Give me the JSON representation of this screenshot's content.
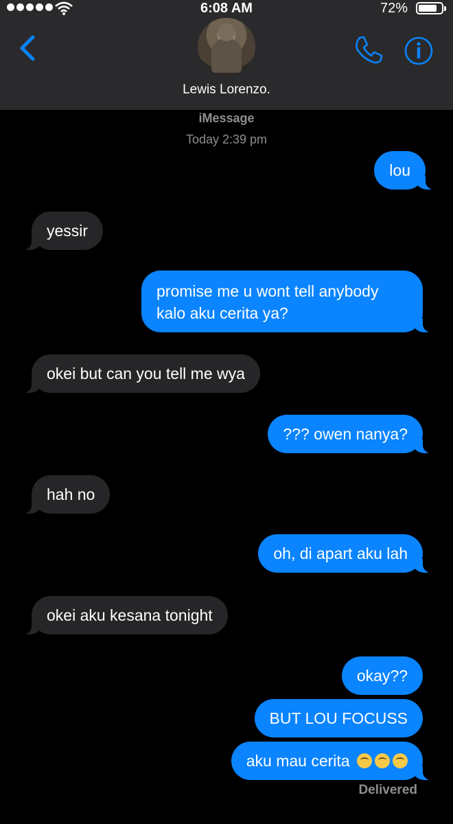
{
  "status_bar": {
    "time": "6:08 AM",
    "battery": "72%",
    "battery_level": 0.72
  },
  "header": {
    "contact_name": "Lewis Lorenzo."
  },
  "conversation": {
    "service": "iMessage",
    "timestamp": "Today 2:39 pm",
    "delivered": "Delivered",
    "emoji_after_last": "🥲🥲🥲"
  },
  "messages": [
    {
      "from": "me",
      "text": "lou"
    },
    {
      "from": "them",
      "text": "yessir"
    },
    {
      "from": "me",
      "text": "promise me u wont tell anybody kalo aku cerita ya?"
    },
    {
      "from": "them",
      "text": "okei but can you tell me wya"
    },
    {
      "from": "me",
      "text": "??? owen nanya?"
    },
    {
      "from": "them",
      "text": "hah no"
    },
    {
      "from": "me",
      "text": "oh, di apart aku lah"
    },
    {
      "from": "them",
      "text": "okei aku kesana tonight"
    },
    {
      "from": "me",
      "text": "okay??"
    },
    {
      "from": "me",
      "text": "BUT LOU FOCUSS"
    },
    {
      "from": "me",
      "text": "aku mau cerita"
    }
  ],
  "colors": {
    "sent_bubble": "#0a84ff",
    "received_bubble": "#262628",
    "accent": "#0a84ff"
  },
  "icons": [
    "back-chevron-icon",
    "phone-icon",
    "info-icon",
    "wifi-icon",
    "battery-icon"
  ]
}
